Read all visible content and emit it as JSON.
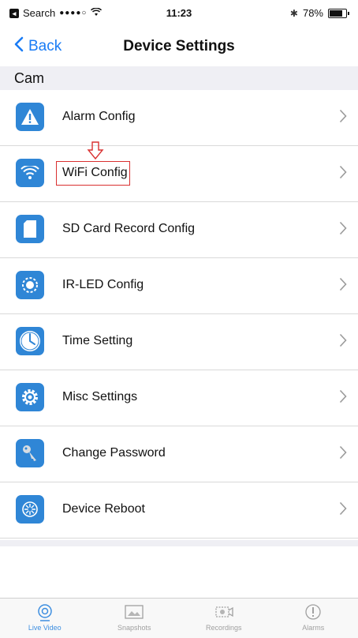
{
  "status_bar": {
    "back_app": "Search",
    "signal": "●●●●○",
    "time": "11:23",
    "battery_pct_text": "78%",
    "battery_level": 0.78
  },
  "nav": {
    "back_label": "Back",
    "title": "Device Settings"
  },
  "section": {
    "header": "Cam"
  },
  "items": [
    {
      "label": "Alarm Config",
      "icon": "alarm-warning-icon"
    },
    {
      "label": "WiFi Config",
      "icon": "wifi-icon"
    },
    {
      "label": "SD Card Record Config",
      "icon": "sd-card-icon"
    },
    {
      "label": "IR-LED Config",
      "icon": "ir-led-icon"
    },
    {
      "label": "Time Setting",
      "icon": "clock-icon"
    },
    {
      "label": "Misc Settings",
      "icon": "gear-icon"
    },
    {
      "label": "Change Password",
      "icon": "key-icon"
    },
    {
      "label": "Device Reboot",
      "icon": "reboot-icon"
    }
  ],
  "tabs": [
    {
      "label": "Live Video",
      "icon": "live-video-icon",
      "active": true
    },
    {
      "label": "Snapshots",
      "icon": "snapshots-icon",
      "active": false
    },
    {
      "label": "Recordings",
      "icon": "recordings-icon",
      "active": false
    },
    {
      "label": "Alarms",
      "icon": "alarms-icon",
      "active": false
    }
  ],
  "colors": {
    "accent": "#1a7cf5",
    "icon_bg": "#2f86d6",
    "annotation": "#d93030"
  }
}
